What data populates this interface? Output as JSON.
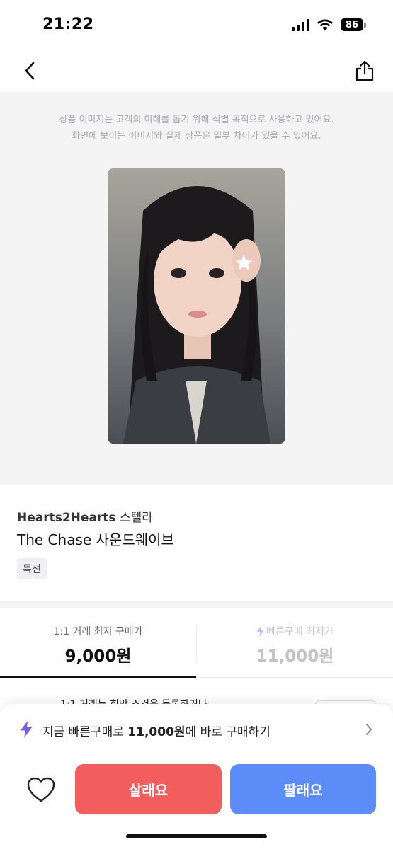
{
  "status_bar": {
    "time": "21:22",
    "battery": "86"
  },
  "nav": {
    "back_icon": "chevron-left-icon",
    "share_icon": "share-icon"
  },
  "image_area": {
    "notice_line1": "상품 이미지는 고객의 이해를 돕기 위해 식별 목적으로 사용하고 있어요.",
    "notice_line2": "화면에 보이는 이미지와 실제 상품은 일부 차이가 있을 수 있어요."
  },
  "product": {
    "artist": "Hearts2Hearts",
    "member": "스텔라",
    "title": "The Chase 사운드웨이브",
    "tag": "특전"
  },
  "price_tabs": {
    "direct": {
      "label": "1:1 거래 최저 구매가",
      "price": "9,000원"
    },
    "quick": {
      "label": "빠른구매 최저가",
      "price": "11,000원",
      "icon": "bolt-icon"
    }
  },
  "peek": {
    "text": "1:1 거래는 희망 조건을 등록하거나"
  },
  "bottom_sheet": {
    "quick_prefix": "지금 빠른구매로 ",
    "quick_price": "11,000원",
    "quick_suffix": "에 바로 구매하기",
    "buy_label": "살래요",
    "sell_label": "팔래요"
  },
  "colors": {
    "buy": "#f25e5e",
    "sell": "#5c8cf7",
    "quick_accent": "#7b5ce0"
  }
}
